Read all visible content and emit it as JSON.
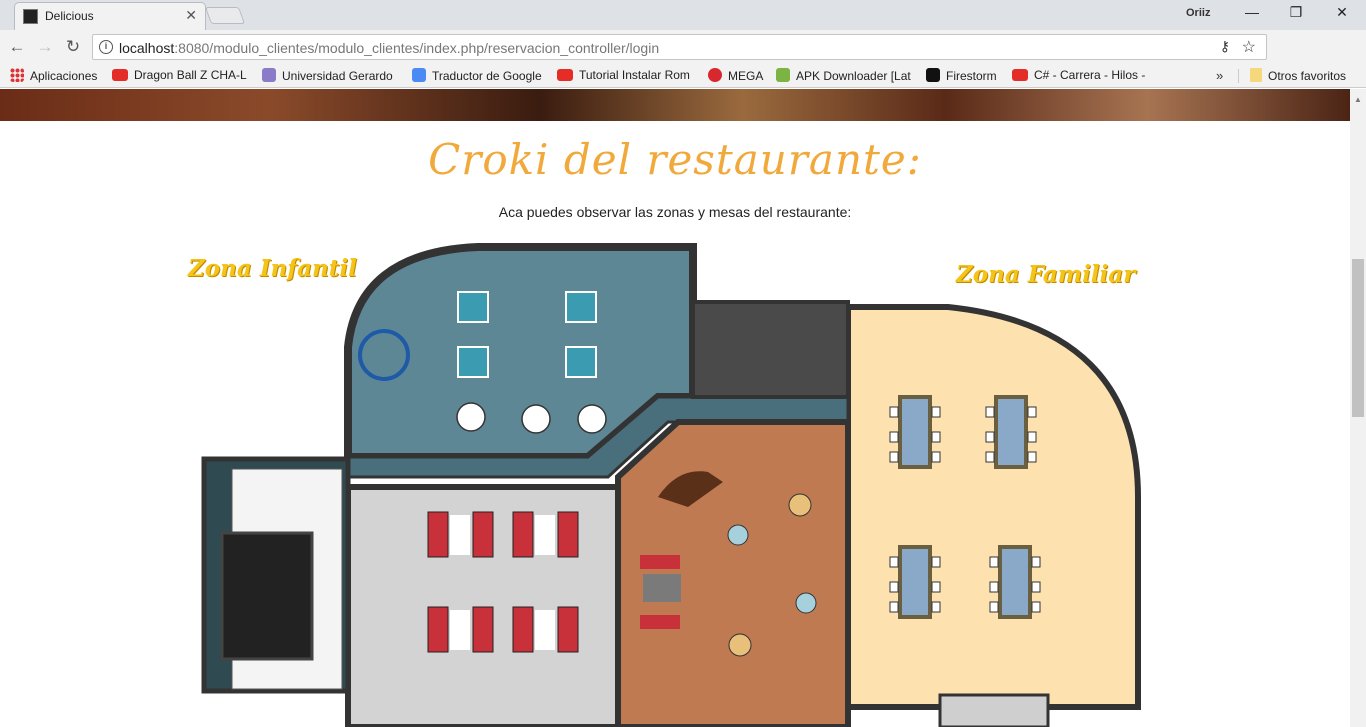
{
  "browser": {
    "tab_title": "Delicious",
    "tab_close": "✕",
    "profile_name": "Oriiz",
    "url_host": "localhost",
    "url_rest": ":8080/modulo_clientes/modulo_clientes/index.php/reservacion_controller/login",
    "window_min": "—",
    "window_restore": "❐",
    "window_close": "✕",
    "back": "←",
    "forward": "→",
    "reload": "↻",
    "star": "☆",
    "key": "⚷"
  },
  "bookmarks": {
    "apps": "Aplicaciones",
    "items": [
      "Dragon Ball Z CHA-L",
      "Universidad Gerardo",
      "Traductor de Google",
      "Tutorial Instalar Rom",
      "MEGA",
      "APK Downloader [Lat",
      "Firestorm",
      "C# - Carrera - Hilos -"
    ],
    "more": "»",
    "other": "Otros favoritos"
  },
  "page": {
    "heading": "Croki del restaurante:",
    "subtitle": "Aca puedes observar las zonas y mesas del restaurante:",
    "zone_left": "Zona Infantil",
    "zone_right": "Zona Familiar"
  },
  "colors": {
    "heading": "#f0a93a",
    "zone_label": "#f5c418",
    "family_floor": "#fde2b0",
    "kids_floor": "#5e8796",
    "wood_floor": "#c07a52",
    "wall": "#3a3a3a"
  }
}
